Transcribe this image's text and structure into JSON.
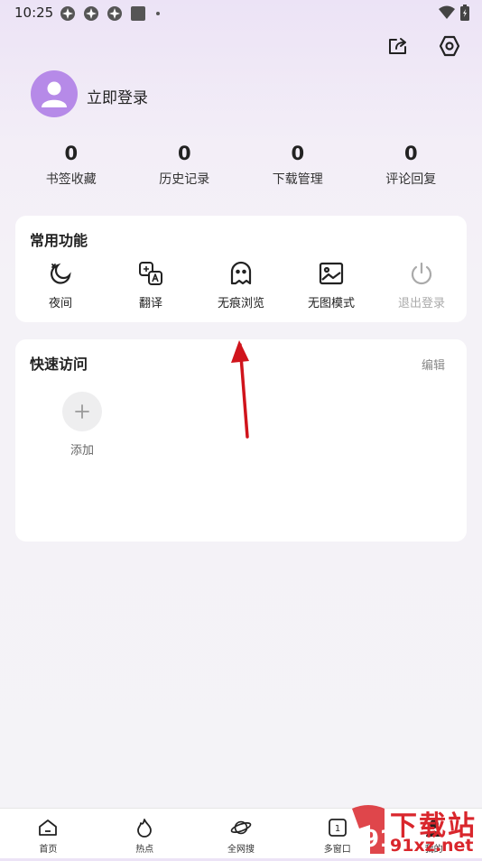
{
  "status_bar": {
    "time": "10:25"
  },
  "profile": {
    "login_label": "立即登录"
  },
  "stats": [
    {
      "value": "0",
      "label": "书签收藏"
    },
    {
      "value": "0",
      "label": "历史记录"
    },
    {
      "value": "0",
      "label": "下载管理"
    },
    {
      "value": "0",
      "label": "评论回复"
    }
  ],
  "common_functions": {
    "title": "常用功能",
    "items": [
      {
        "label": "夜间",
        "icon": "moon-icon"
      },
      {
        "label": "翻译",
        "icon": "translate-icon"
      },
      {
        "label": "无痕浏览",
        "icon": "ghost-icon"
      },
      {
        "label": "无图模式",
        "icon": "image-icon"
      },
      {
        "label": "退出登录",
        "icon": "power-icon"
      }
    ]
  },
  "quick_access": {
    "title": "快速访问",
    "edit_label": "编辑",
    "add_label": "添加"
  },
  "bottom_nav": [
    {
      "label": "首页",
      "icon": "home-icon"
    },
    {
      "label": "热点",
      "icon": "flame-icon"
    },
    {
      "label": "全网搜",
      "icon": "planet-icon"
    },
    {
      "label": "多窗口",
      "icon": "windows-icon",
      "badge": "1"
    },
    {
      "label": "我的",
      "icon": "user-icon"
    }
  ],
  "watermark": {
    "text": "下载站",
    "domain": "91xz.net",
    "number": "91"
  },
  "colors": {
    "accent": "#b68ae8",
    "arrow": "#d0141c",
    "watermark_red": "#d9262c"
  }
}
